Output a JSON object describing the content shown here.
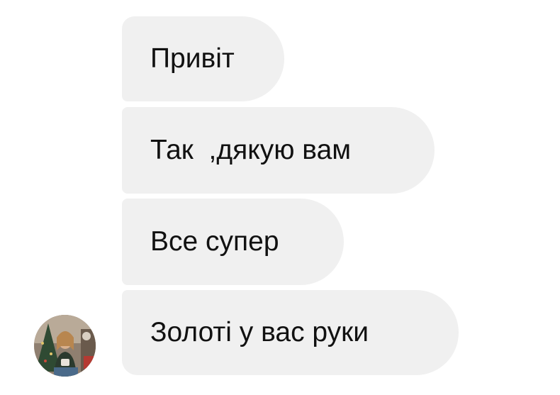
{
  "conversation": {
    "messages": [
      {
        "text": "Привіт"
      },
      {
        "text": "Так  ,дякую вам"
      },
      {
        "text": "Все супер"
      },
      {
        "text": "Золоті у вас руки"
      }
    ]
  },
  "sender": {
    "avatar_icon": "user-photo-avatar"
  },
  "colors": {
    "bubble_bg": "#f0f0f0",
    "text": "#111111",
    "background": "#ffffff"
  }
}
